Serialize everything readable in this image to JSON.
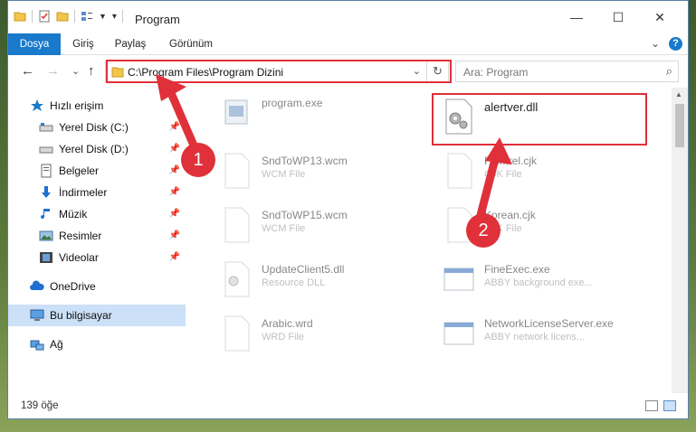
{
  "window": {
    "title": "Program",
    "minimize": "—",
    "maximize": "☐",
    "close": "✕"
  },
  "ribbon": {
    "tabs": [
      "Dosya",
      "Giriş",
      "Paylaş",
      "Görünüm"
    ],
    "expand": "⌄",
    "help": "?"
  },
  "nav": {
    "back": "←",
    "forward": "→",
    "recent": "⌄",
    "up": "↑",
    "address": "C:\\Program Files\\Program Dizini",
    "address_dropdown": "⌄",
    "refresh": "↻",
    "search_placeholder": "Ara: Program",
    "search_icon": "⌕"
  },
  "sidebar": {
    "items": [
      {
        "label": "Hızlı erişim",
        "icon": "star-icon"
      },
      {
        "label": "Yerel Disk (C:)",
        "icon": "drive-icon",
        "pinned": "📌"
      },
      {
        "label": "Yerel Disk (D:)",
        "icon": "drive-icon",
        "pinned": "📌"
      },
      {
        "label": "Belgeler",
        "icon": "document-icon",
        "pinned": "📌"
      },
      {
        "label": "İndirmeler",
        "icon": "download-icon",
        "pinned": "📌"
      },
      {
        "label": "Müzik",
        "icon": "music-icon",
        "pinned": "📌"
      },
      {
        "label": "Resimler",
        "icon": "pictures-icon",
        "pinned": "📌"
      },
      {
        "label": "Videolar",
        "icon": "video-icon",
        "pinned": "📌"
      },
      {
        "label": "OneDrive",
        "icon": "cloud-icon"
      },
      {
        "label": "Bu bilgisayar",
        "icon": "computer-icon"
      },
      {
        "label": "Ağ",
        "icon": "network-icon"
      }
    ]
  },
  "files": [
    {
      "name": "program.exe",
      "type": ""
    },
    {
      "name": "alertver.dll",
      "type": ""
    },
    {
      "name": "SndToWP13.wcm",
      "type": "WCM File"
    },
    {
      "name": "Finntrel.cjk",
      "type": "CJK File"
    },
    {
      "name": "SndToWP15.wcm",
      "type": "WCM File"
    },
    {
      "name": "Korean.cjk",
      "type": "CJK File"
    },
    {
      "name": "UpdateClient5.dll",
      "type": "Resource DLL"
    },
    {
      "name": "FineExec.exe",
      "type": "ABBY background exe..."
    },
    {
      "name": "Arabic.wrd",
      "type": "WRD File"
    },
    {
      "name": "NetworkLicenseServer.exe",
      "type": "ABBY network licens..."
    }
  ],
  "status": {
    "count": "139 öğe"
  },
  "annotations": {
    "step1": "1",
    "step2": "2"
  },
  "colors": {
    "accent": "#1979ca",
    "highlight": "#e0303a",
    "selection": "#cce0f7"
  }
}
